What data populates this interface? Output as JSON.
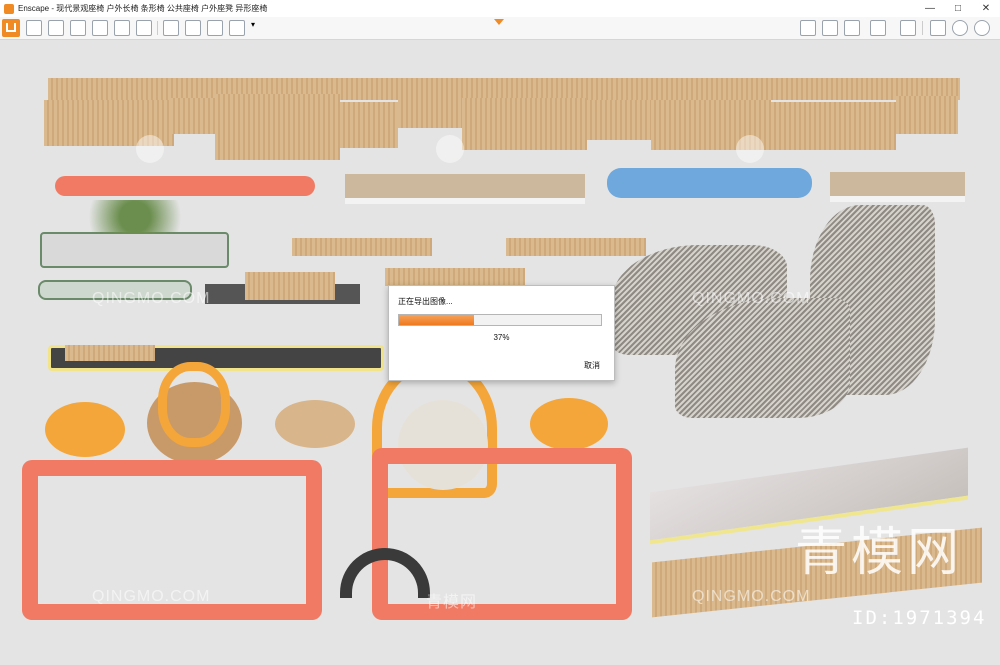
{
  "window": {
    "title": "Enscape - 现代景观座椅 户外长椅 条形椅 公共座椅 户外座凳 异形座椅",
    "controls": {
      "minimize": "—",
      "maximize": "□",
      "close": "✕"
    }
  },
  "toolbar": {
    "left_icons": [
      "home-icon",
      "asset-library-icon",
      "bim-icon",
      "view-binoculars-icon",
      "capture-icon",
      "upload-icon",
      "building-icon",
      "materials-icon",
      "screenshot-icon",
      "batch-render-icon",
      "panorama-icon",
      "export-icon",
      "chevron-down-icon"
    ],
    "right_icons": [
      "map-icon",
      "settings-panel-icon",
      "cube-icon",
      "library-icon",
      "export-3d-icon",
      "visibility-icon",
      "gear-icon",
      "help-icon"
    ]
  },
  "dialog": {
    "title": "正在导出图像...",
    "progress": 0.37,
    "progress_label": "37%",
    "cancel_label": "取消"
  },
  "watermark": {
    "text": "QINGMO.COM",
    "text_cn": "青模网",
    "brand": "青模网",
    "id": "ID:1971394"
  }
}
